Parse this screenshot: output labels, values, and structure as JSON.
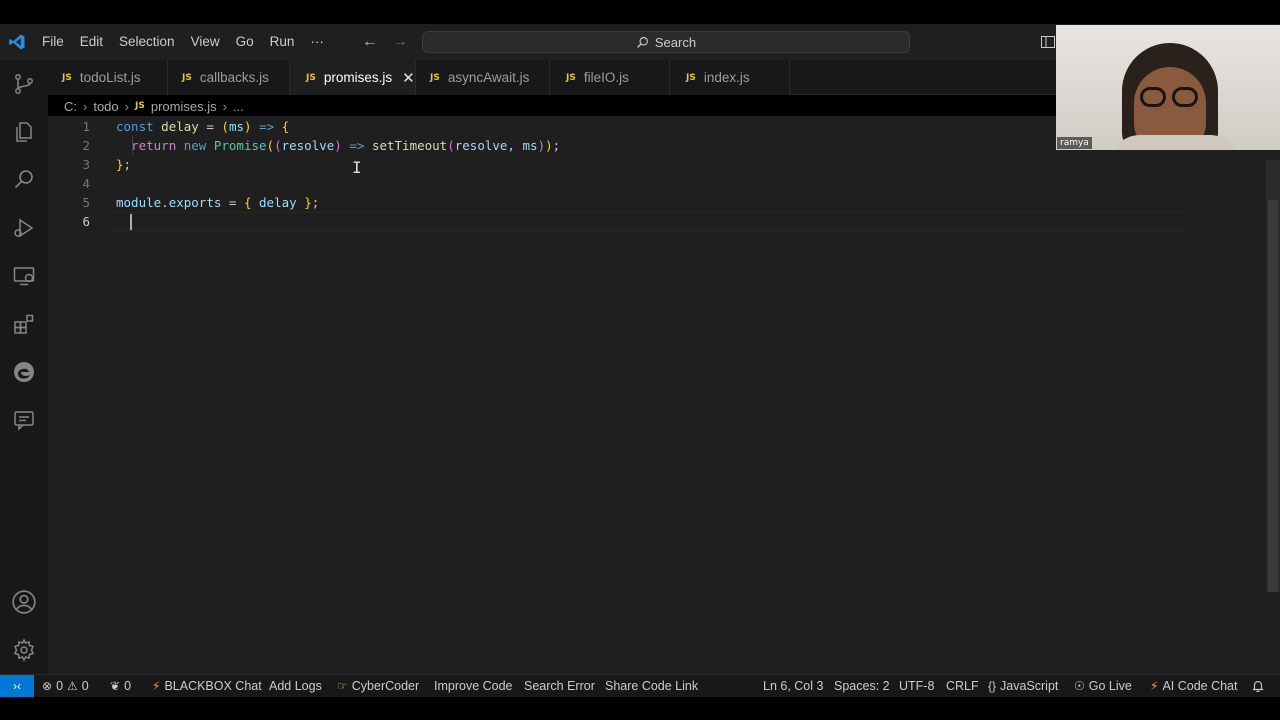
{
  "menu": [
    "File",
    "Edit",
    "Selection",
    "View",
    "Go",
    "Run",
    "···"
  ],
  "search": {
    "label": "Search"
  },
  "tabs": [
    {
      "label": "todoList.js",
      "icon": "JS"
    },
    {
      "label": "callbacks.js",
      "icon": "JS"
    },
    {
      "label": "promises.js",
      "icon": "JS",
      "active": true
    },
    {
      "label": "asyncAwait.js",
      "icon": "JS"
    },
    {
      "label": "fileIO.js",
      "icon": "JS"
    },
    {
      "label": "index.js",
      "icon": "JS"
    }
  ],
  "breadcrumb": {
    "drive": "C:",
    "folder": "todo",
    "icon": "JS",
    "file": "promises.js",
    "more": "..."
  },
  "editor": {
    "line_numbers": [
      "1",
      "2",
      "3",
      "4",
      "5",
      "6"
    ],
    "lines": [
      "const delay = (ms) => {",
      "  return new Promise((resolve) => setTimeout(resolve, ms));",
      "};",
      "",
      "module.exports = { delay };",
      ""
    ]
  },
  "webcam": {
    "name_label": "ramya"
  },
  "statusbar": {
    "errors": "0",
    "warnings": "0",
    "ports": "0",
    "blackbox_chat": "BLACKBOX Chat",
    "add_logs": "Add Logs",
    "cyber_coder": "CyberCoder",
    "improve_code": "Improve Code",
    "search_error": "Search Error",
    "share_code_link": "Share Code Link",
    "cursor_position": "Ln 6, Col 3",
    "spaces": "Spaces: 2",
    "encoding": "UTF-8",
    "eol": "CRLF",
    "language": "JavaScript",
    "go_live": "Go Live",
    "ai_code_chat": "AI Code Chat"
  },
  "colors": {
    "accent": "#0078d4",
    "js_icon": "#e5c23d",
    "editor_bg": "#1f1f1f"
  }
}
